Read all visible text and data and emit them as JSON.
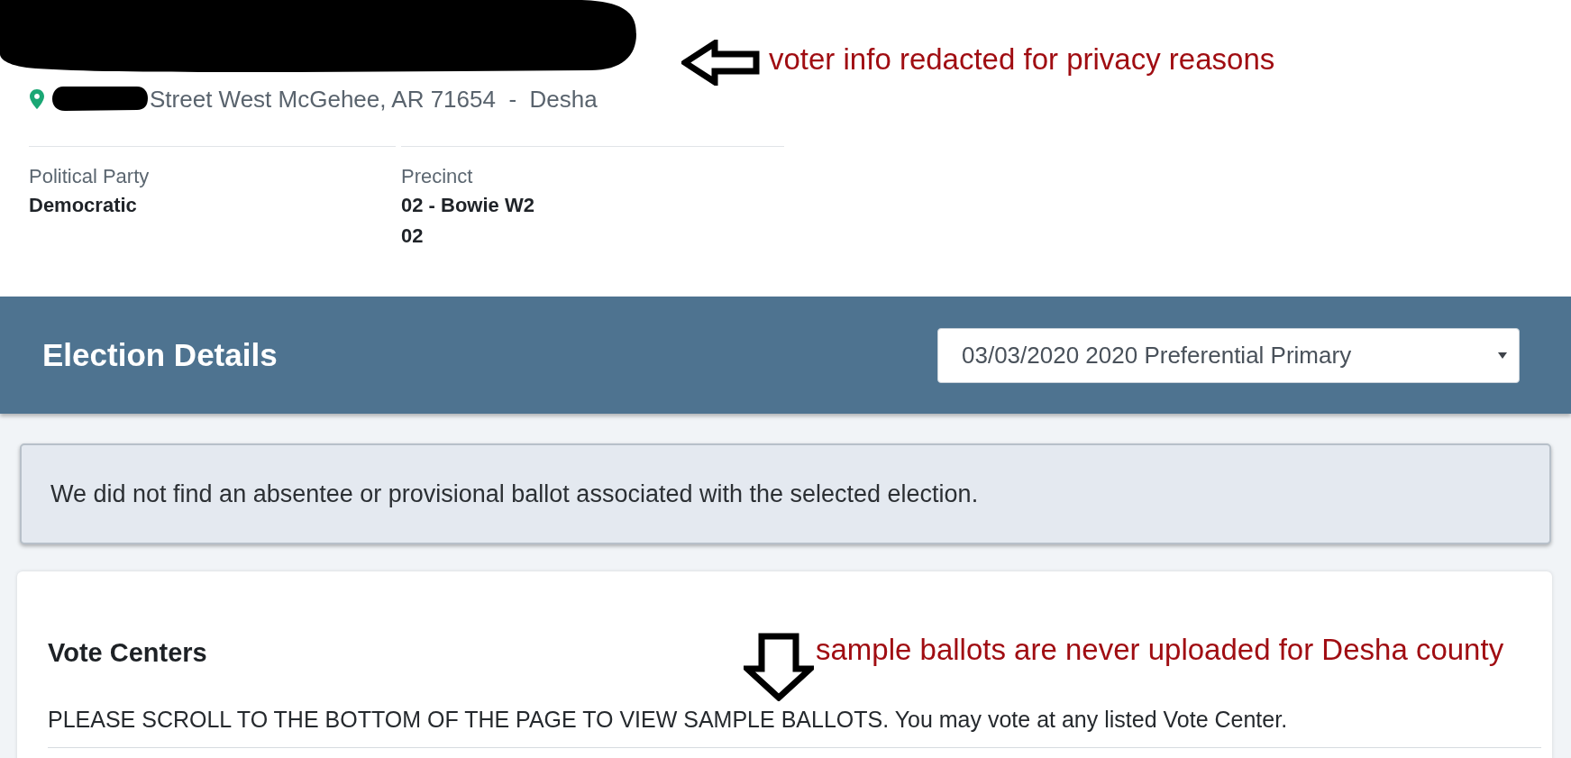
{
  "voter": {
    "address": "Street West McGehee, AR 71654  -  Desha",
    "note": {
      "kind": "left",
      "text": "voter info redacted for privacy reasons"
    },
    "fields": [
      {
        "label": "Political Party",
        "values": [
          "Democratic"
        ]
      },
      {
        "label": "Precinct",
        "values": [
          "02 - Bowie W2",
          "02"
        ]
      }
    ]
  },
  "election_details": {
    "title": "Election Details",
    "election_select": {
      "value": "03/03/2020 2020 Preferential Primary"
    }
  },
  "alert": {
    "text": "We did not find an absentee or provisional ballot associated with the selected election."
  },
  "vote_centers": {
    "title": "Vote Centers",
    "note": {
      "kind": "down",
      "text": "sample ballots are never uploaded for Desha county"
    },
    "instructions": "PLEASE SCROLL TO THE BOTTOM OF THE PAGE TO VIEW SAMPLE BALLOTS. You may vote at any listed Vote Center."
  }
}
